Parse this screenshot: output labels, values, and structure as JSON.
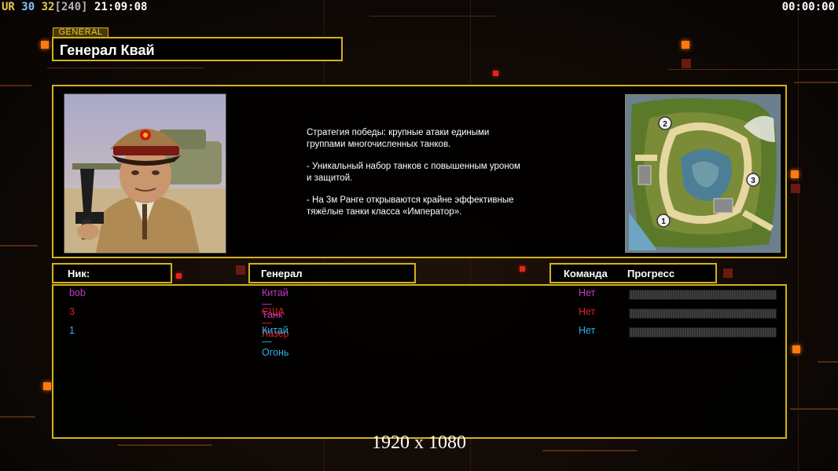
{
  "hud": {
    "ur": "UR",
    "n30": "30",
    "n32": "32",
    "n240": "[240]",
    "clock": "21:09:08",
    "timer": "00:00:00"
  },
  "header": {
    "tag": "GENERAL",
    "title": "Генерал Квай"
  },
  "description": {
    "p1": "Стратегия победы: крупные атаки едиными\n группами многочисленных танков.",
    "p2": "- Уникальный набор танков с повышенным уроном\n и защитой.",
    "p3": "- На 3м Ранге открываются крайне эффективные\n тяжёлые танки класса «Император»."
  },
  "columns": {
    "nick": "Ник:",
    "general": "Генерал",
    "team": "Команда",
    "progress": "Прогресс"
  },
  "players": [
    {
      "nick": "bob",
      "general": "Китай — Танк",
      "team": "Нет",
      "color": "#c23ac4"
    },
    {
      "nick": "3",
      "general": "США — Лазер",
      "team": "Нет",
      "color": "#e02020"
    },
    {
      "nick": "1",
      "general": "Китай — Огонь",
      "team": "Нет",
      "color": "#2ab4e8"
    }
  ],
  "map": {
    "spawn_labels": [
      "2",
      "3",
      "1"
    ]
  },
  "footer": {
    "resolution": "1920 x 1080"
  },
  "colors": {
    "accent_gold": "#d4b21a",
    "deco_orange": "#ff7a10"
  }
}
